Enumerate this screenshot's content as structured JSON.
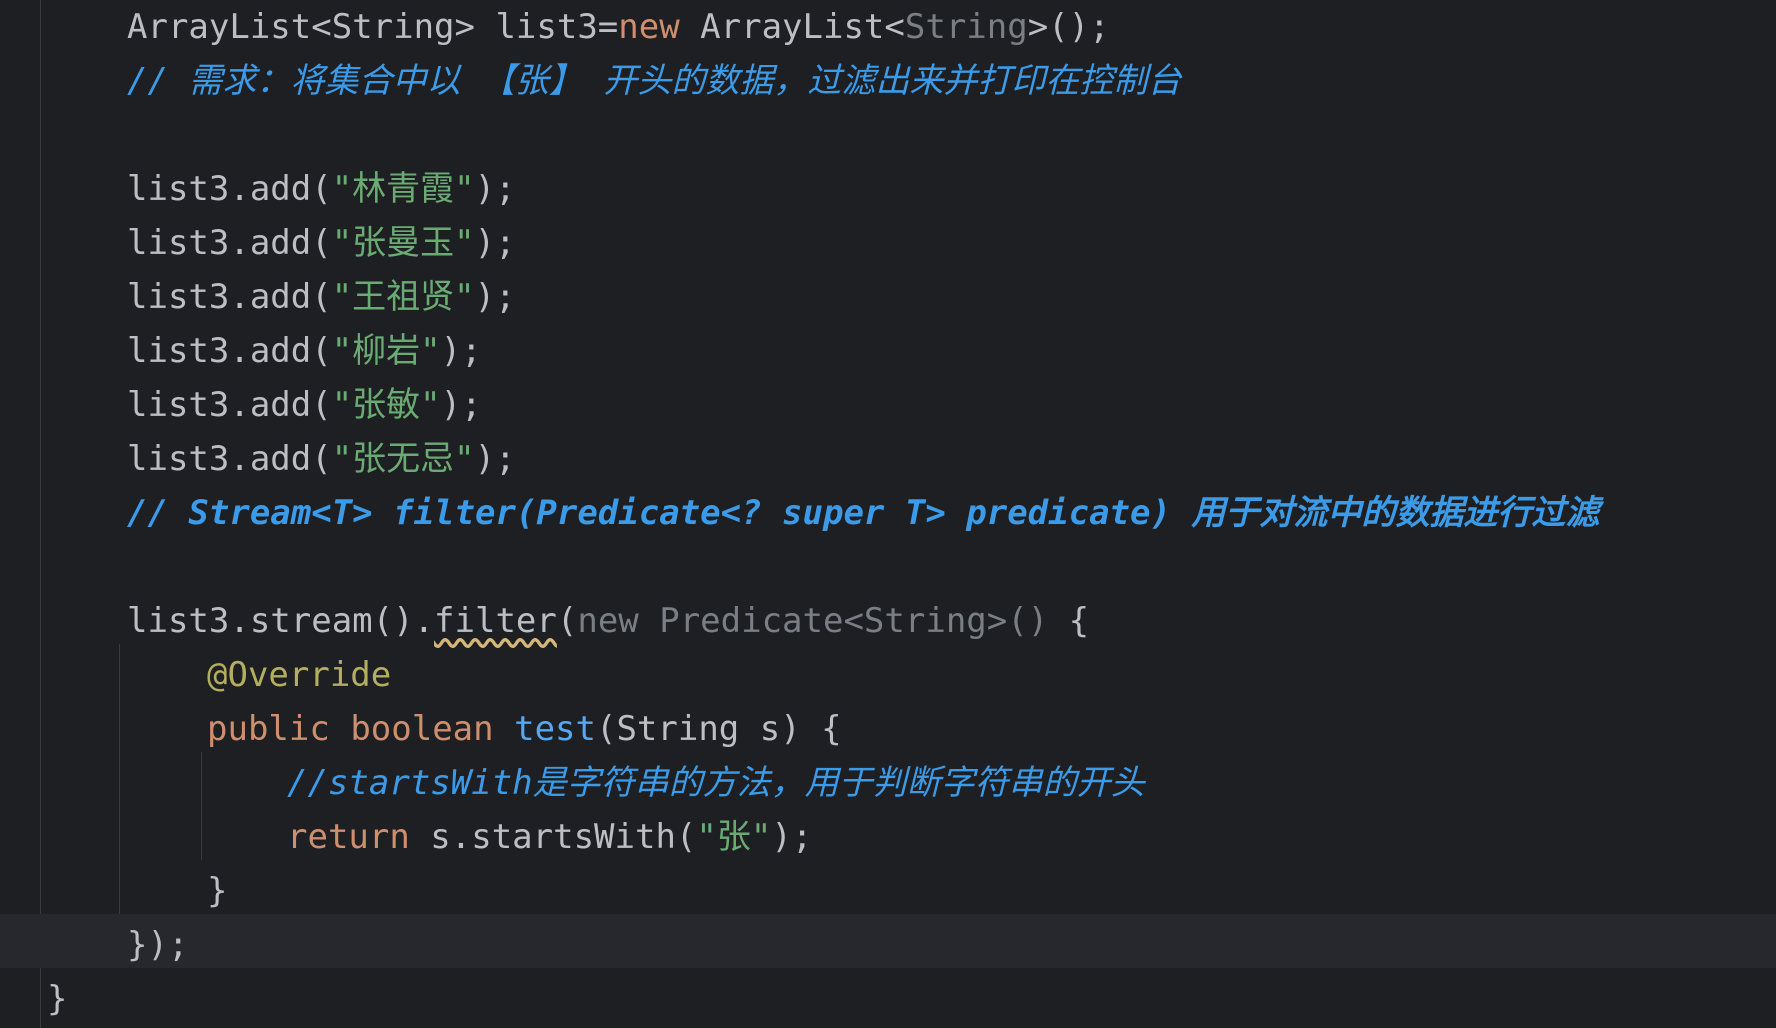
{
  "code": {
    "line1": {
      "p1": "ArrayList<String> list3=",
      "kw": "new",
      "p2": " ArrayList<",
      "dim": "String",
      "p3": ">();"
    },
    "line2_comment": "// 需求：将集合中以 【张】 开头的数据，过滤出来并打印在控制台",
    "adds": [
      {
        "prefix": "list3.add(",
        "str": "\"林青霞\"",
        "suffix": ");"
      },
      {
        "prefix": "list3.add(",
        "str": "\"张曼玉\"",
        "suffix": ");"
      },
      {
        "prefix": "list3.add(",
        "str": "\"王祖贤\"",
        "suffix": ");"
      },
      {
        "prefix": "list3.add(",
        "str": "\"柳岩\"",
        "suffix": ");"
      },
      {
        "prefix": "list3.add(",
        "str": "\"张敏\"",
        "suffix": ");"
      },
      {
        "prefix": "list3.add(",
        "str": "\"张无忌\"",
        "suffix": ");"
      }
    ],
    "filter_comment": "// Stream<T> filter(Predicate<? super T> predicate) 用于对流中的数据进行过滤",
    "stream_line": {
      "p1": "list3.stream().",
      "method": "filter",
      "p2": "(",
      "dim": "new Predicate<String>()",
      "p3": " {"
    },
    "override": "@Override",
    "test_line": {
      "kw1": "public",
      "kw2": "boolean",
      "fn": "test",
      "rest": "(String s) {"
    },
    "starts_comment": "//startsWith是字符串的方法，用于判断字符串的开头",
    "return_line": {
      "kw": "return",
      "p1": " s.startsWith(",
      "str": "\"张\"",
      "p2": ");"
    },
    "close_brace": "}",
    "close_call": "});",
    "close_method": "}"
  },
  "colors": {
    "background": "#1e1f22",
    "text": "#bcbec4",
    "keyword": "#cf8e6d",
    "string": "#6aab73",
    "comment": "#3b9be8",
    "annotation": "#b3ae60",
    "function": "#56a8f5",
    "current_line": "#26282e"
  }
}
